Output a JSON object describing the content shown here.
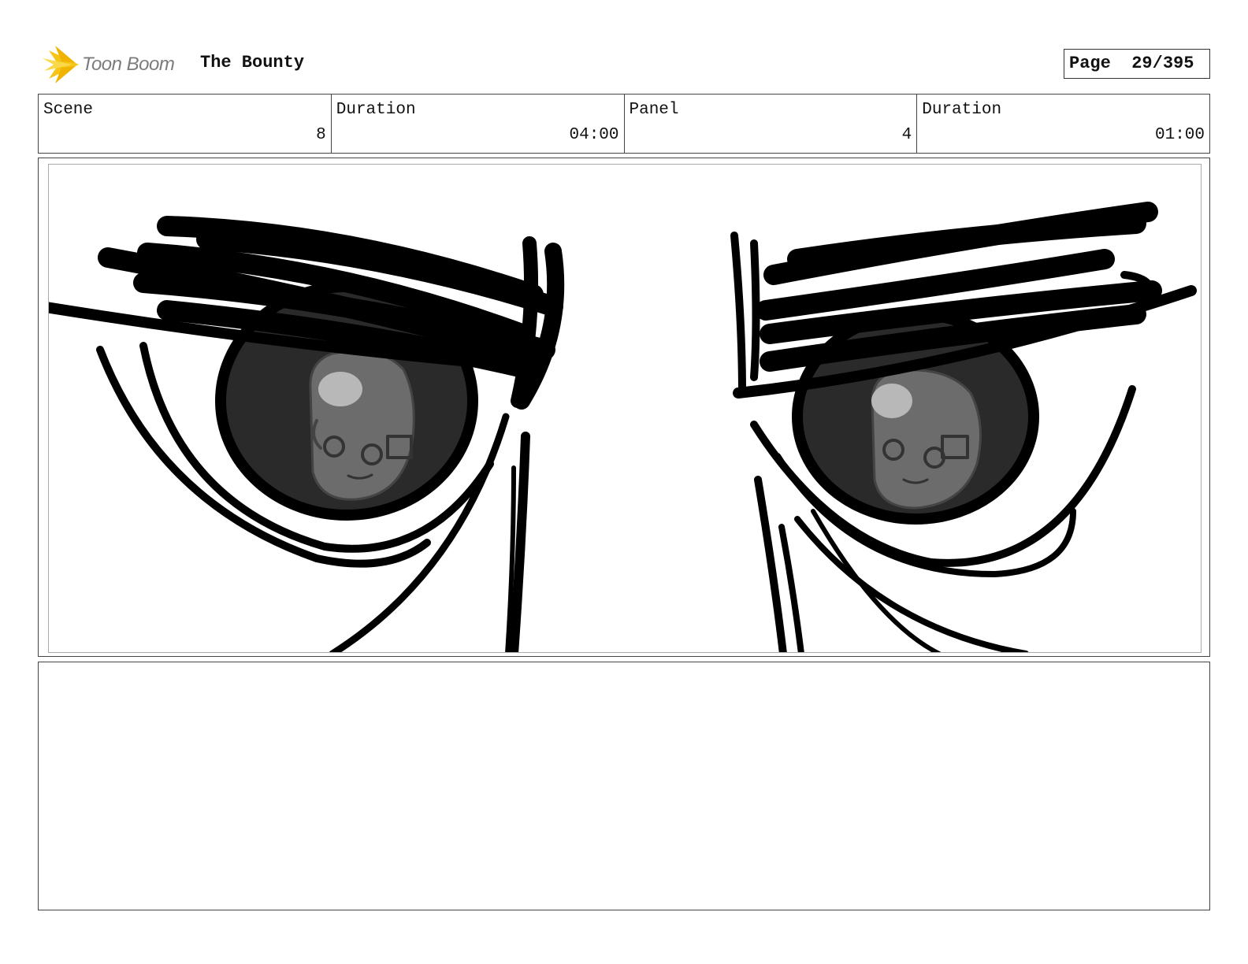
{
  "header": {
    "logo_text": "Toon Boom",
    "project_title": "The Bounty",
    "page_label": "Page",
    "page_number": "29/395"
  },
  "info": [
    {
      "label": "Scene",
      "value": "8"
    },
    {
      "label": "Duration",
      "value": "04:00"
    },
    {
      "label": "Panel",
      "value": "4"
    },
    {
      "label": "Duration",
      "value": "01:00"
    }
  ],
  "panel": {
    "image": "close-up sketch of two angry eyes with reflected faces in pupils"
  },
  "notes": {
    "text": ""
  }
}
